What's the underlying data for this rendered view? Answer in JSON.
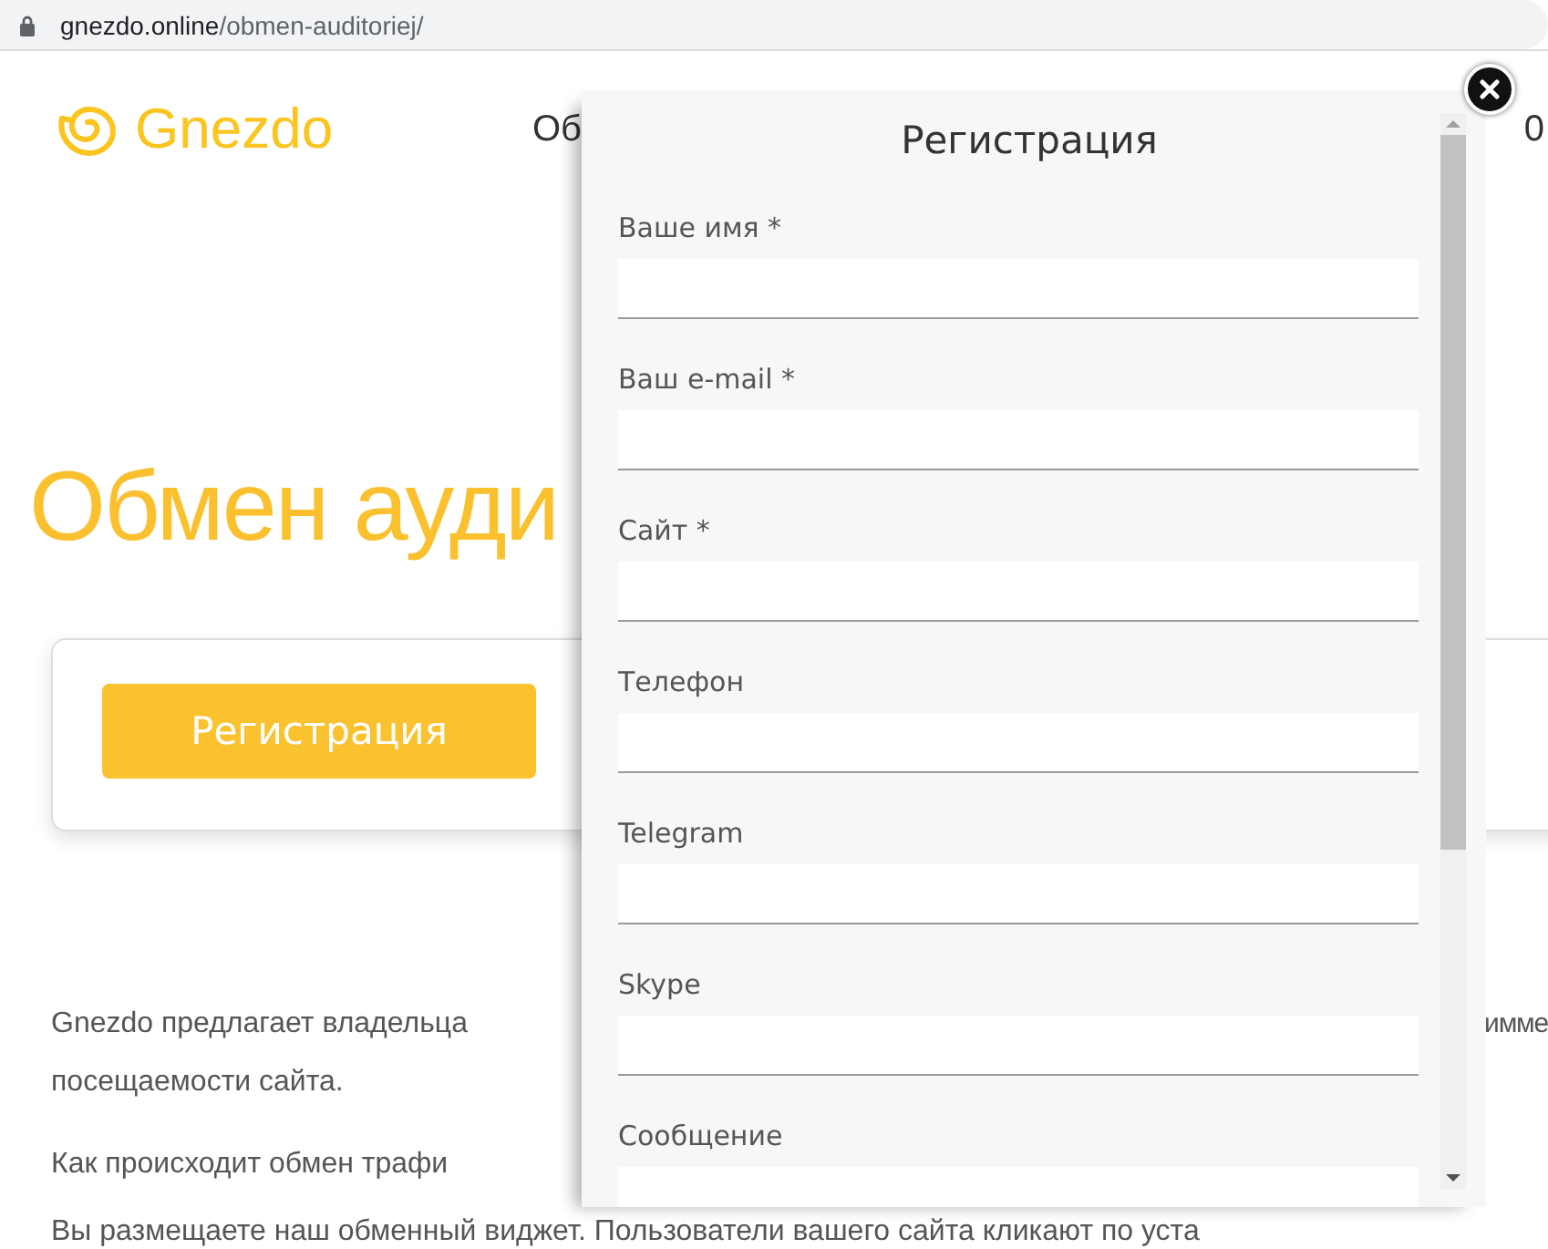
{
  "browser": {
    "url_host": "gnezdo.online",
    "url_path": "/obmen-auditoriej/"
  },
  "header": {
    "logo": "Gnezdo",
    "nav": [
      "Об",
      "0"
    ]
  },
  "hero": {
    "title": "Обмен ауди"
  },
  "card": {
    "button": "Регистрация"
  },
  "paragraphs": [
    {
      "left": "Gnezdo предлагает владельца",
      "right": "имме"
    },
    {
      "left": "посещаемости сайта."
    },
    {
      "left": "Как происходит обмен трафи"
    },
    {
      "left": "Вы размещаете наш обменный виджет. Пользователи вашего сайта кликают по уста"
    }
  ],
  "modal": {
    "title": "Регистрация",
    "fields": [
      {
        "label": "Ваше имя *",
        "kind": "input"
      },
      {
        "label": "Ваш e-mail *",
        "kind": "input"
      },
      {
        "label": "Сайт *",
        "kind": "input"
      },
      {
        "label": "Телефон",
        "kind": "input"
      },
      {
        "label": "Telegram",
        "kind": "input"
      },
      {
        "label": "Skype",
        "kind": "input"
      },
      {
        "label": "Сообщение",
        "kind": "textarea"
      }
    ]
  }
}
